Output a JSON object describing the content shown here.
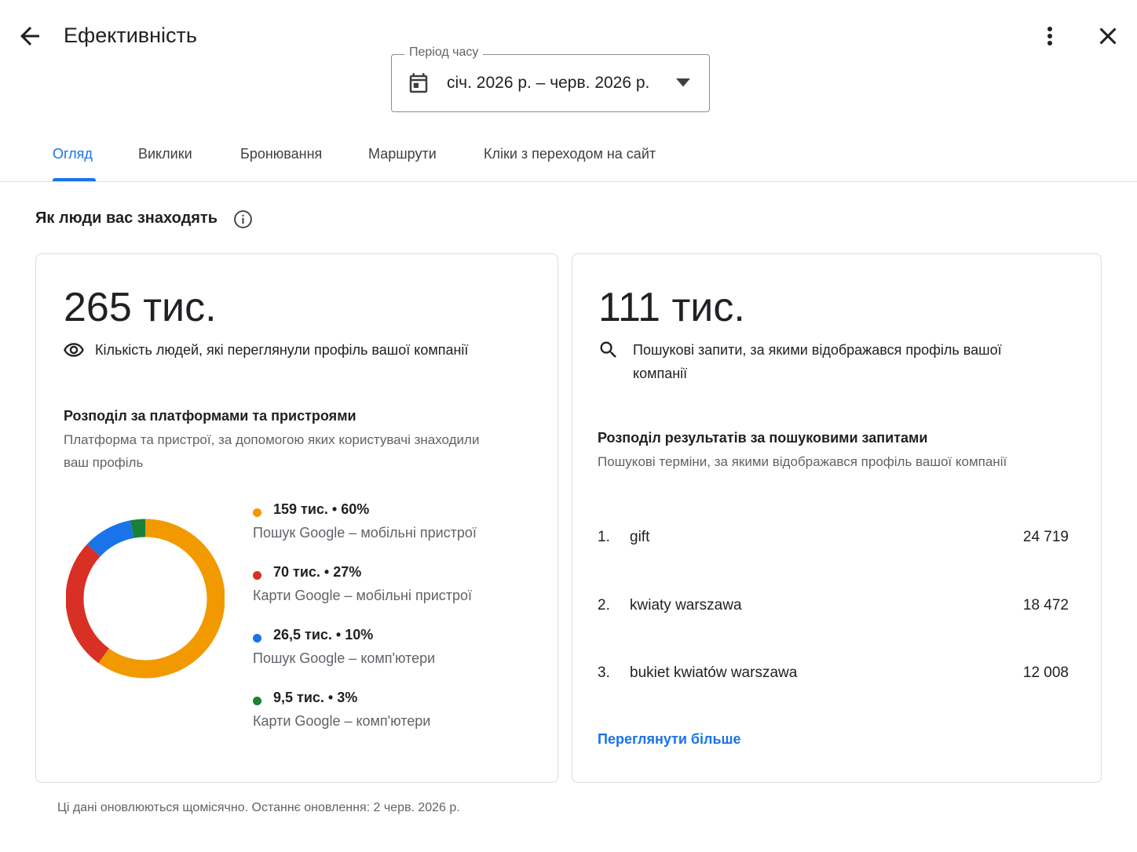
{
  "header": {
    "title": "Ефективність",
    "back_icon": "arrow-back-icon",
    "more_icon": "more-vert-icon",
    "close_icon": "close-icon"
  },
  "period": {
    "label": "Період часу",
    "value": "січ. 2026 р. – черв. 2026 р.",
    "icon": "calendar-icon"
  },
  "tabs": [
    {
      "label": "Огляд",
      "active": true
    },
    {
      "label": "Виклики",
      "active": false
    },
    {
      "label": "Бронювання",
      "active": false
    },
    {
      "label": "Маршрути",
      "active": false
    },
    {
      "label": "Кліки з переходом на сайт",
      "active": false
    }
  ],
  "section": {
    "title": "Як люди вас знаходять",
    "info_icon": "info-icon"
  },
  "profile_views": {
    "total": "265 тис.",
    "caption": "Кількість людей, які переглянули профіль вашої компанії",
    "icon": "eye-icon",
    "breakdown_title": "Розподіл за платформами та пристроями",
    "breakdown_desc_line1": "Платформа та пристрої, за допомогою яких користувачі знаходили",
    "breakdown_desc_line2": "ваш профіль"
  },
  "chart_data": {
    "type": "pie",
    "variant": "donut",
    "categories": [
      "Пошук Google – мобільні пристрої",
      "Карти Google – мобільні пристрої",
      "Пошук Google – комп'ютери",
      "Карти Google – комп'ютери"
    ],
    "values": [
      60,
      27,
      10,
      3
    ],
    "value_labels": [
      "159 тис. • 60%",
      "70 тис. • 27%",
      "26,5 тис. • 10%",
      "9,5 тис. • 3%"
    ],
    "colors": [
      "#f29900",
      "#d93025",
      "#1a73e8",
      "#188038"
    ]
  },
  "searches": {
    "total": "111 тис.",
    "caption_line1": "Пошукові запити, за якими відображався профіль вашої",
    "caption_line2": "компанії",
    "icon": "search-icon",
    "breakdown_title": "Розподіл результатів за пошуковими запитами",
    "breakdown_desc": "Пошукові терміни, за якими відображався профіль вашої компанії",
    "queries": [
      {
        "rank": "1.",
        "term": "gift",
        "count": "24 719"
      },
      {
        "rank": "2.",
        "term": "kwiaty warszawa",
        "count": "18 472"
      },
      {
        "rank": "3.",
        "term": "bukiet kwiatów warszawa",
        "count": "12 008"
      }
    ],
    "see_more": "Переглянути більше"
  },
  "footer": {
    "note": "Ці дані оновлюються щомісячно. Останнє оновлення: 2 черв. 2026 р."
  },
  "colors": {
    "accent": "#1a73e8",
    "text_primary": "#202124",
    "text_secondary": "#5f6368",
    "border": "#dadce0"
  }
}
